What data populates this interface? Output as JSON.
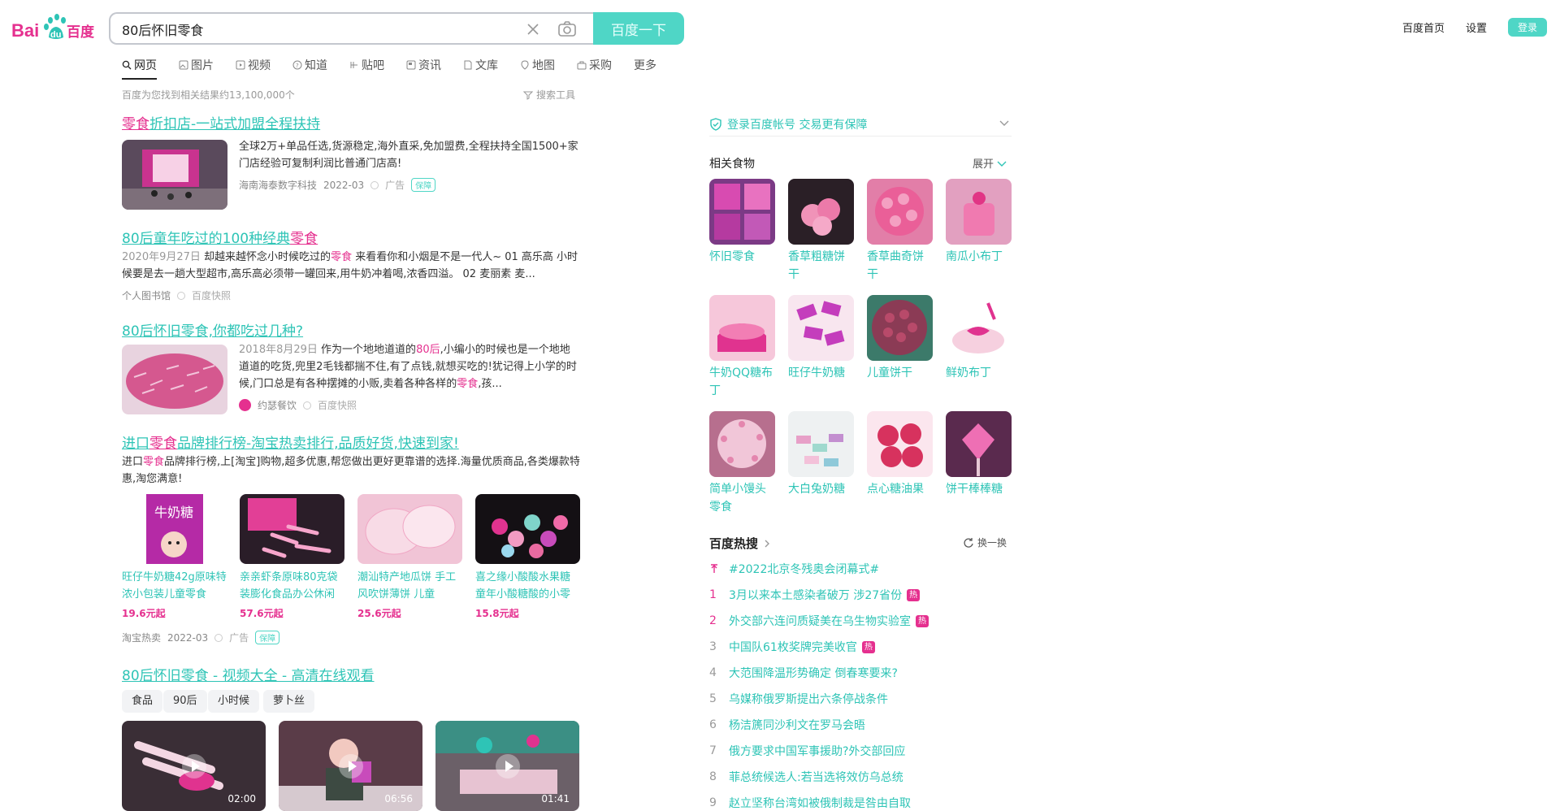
{
  "header": {
    "logo_text_left": "Bai",
    "logo_text_mid": "du",
    "logo_text_right": "百度",
    "search_value": "80后怀旧零食",
    "search_button": "百度一下",
    "links": [
      "百度首页",
      "设置"
    ],
    "login_button": "登录"
  },
  "tabs": [
    {
      "label": "网页",
      "icon": "search-icon",
      "active": true
    },
    {
      "label": "图片",
      "icon": "image-icon"
    },
    {
      "label": "视频",
      "icon": "video-icon"
    },
    {
      "label": "知道",
      "icon": "question-icon"
    },
    {
      "label": "贴吧",
      "icon": "tieba-icon"
    },
    {
      "label": "资讯",
      "icon": "news-icon"
    },
    {
      "label": "文库",
      "icon": "doc-icon"
    },
    {
      "label": "地图",
      "icon": "map-icon"
    },
    {
      "label": "采购",
      "icon": "purchase-icon"
    },
    {
      "label": "更多",
      "icon": ""
    }
  ],
  "results_info": {
    "count_text": "百度为您找到相关结果约13,100,000个",
    "search_tools": "搜索工具"
  },
  "results": [
    {
      "title_hl": "零食",
      "title_rest": "折扣店-一站式加盟全程扶持",
      "desc": "全球2万+单品任选,货源稳定,海外直采,免加盟费,全程扶持全国1500+家门店经验可复制利润比普通门店高!",
      "source": "海南海泰数字科技",
      "date": "2022-03",
      "ad": "广告",
      "guarantee": "保障"
    },
    {
      "title_pre": "80后童年吃过的100种经典",
      "title_hl": "零食",
      "date": "2020年9月27日",
      "desc_a": "却越来越怀念小时候吃过的",
      "desc_hl": "零食",
      "desc_b": " 来看看你和小烟是不是一代人~ 01 高乐高 小时候要是去一趟大型超市,高乐高必须带一罐回来,用牛奶冲着喝,浓香四溢。 02 麦丽素 麦...",
      "source": "个人图书馆",
      "snapshot": "百度快照"
    },
    {
      "title": "80后怀旧零食,你都吃过几种?",
      "date": "2018年8月29日",
      "desc_a": "作为一个地地道道的",
      "desc_hl1": "80后",
      "desc_b": ",小编小的时候也是一个地地道道的吃货,兜里2毛钱都揣不住,有了点钱,就想买吃的!犹记得上小学的时候,门口总是有各种摆摊的小贩,卖着各种各样的",
      "desc_hl2": "零食",
      "desc_c": ",孩...",
      "source": "约瑟餐饮",
      "snapshot": "百度快照"
    },
    {
      "title_pre": "进口",
      "title_hl": "零食",
      "title_rest": "品牌排行榜-淘宝热卖排行,品质好货,快速到家!",
      "desc_a": "进口",
      "desc_hl": "零食",
      "desc_b": "品牌排行榜,上[淘宝]购物,超多优惠,帮您做出更好更靠谱的选择.海量优质商品,各类爆款特惠,淘您满意!",
      "products": [
        {
          "title": "旺仔牛奶糖42g原味特浓小包装儿童零食",
          "price": "19.6元起"
        },
        {
          "title": "亲亲虾条原味80克袋装膨化食品办公休闲",
          "price": "57.6元起"
        },
        {
          "title": "潮汕特产地瓜饼 手工风吹饼薄饼 儿童",
          "price": "25.6元起"
        },
        {
          "title": "喜之缘小酸酸水果糖童年小酸糖酸的小零",
          "price": "15.8元起"
        }
      ],
      "source": "淘宝热卖",
      "date": "2022-03",
      "ad": "广告",
      "guarantee": "保障"
    },
    {
      "title": "80后怀旧零食 - 视频大全 - 高清在线观看",
      "tags": [
        "食品",
        "90后",
        "小时候",
        "萝卜丝"
      ],
      "videos": [
        {
          "duration": "02:00"
        },
        {
          "duration": "06:56"
        },
        {
          "duration": "01:41"
        }
      ]
    }
  ],
  "right": {
    "login_tip": "登录百度帐号 交易更有保障",
    "related_title": "相关食物",
    "expand": "展开",
    "foods": [
      "怀旧零食",
      "香草粗糖饼干",
      "香草曲奇饼干",
      "南瓜小布丁",
      "牛奶QQ糖布丁",
      "旺仔牛奶糖",
      "儿童饼干",
      "鲜奶布丁",
      "简单小馒头零食",
      "大白兔奶糖",
      "点心糖油果",
      "饼干棒棒糖"
    ],
    "hot_title": "百度热搜",
    "refresh": "换一换",
    "hot": [
      {
        "rank": "",
        "text": "#2022北京冬残奥会闭幕式#",
        "badge": ""
      },
      {
        "rank": "1",
        "text": "3月以来本土感染者破万 涉27省份",
        "badge": "热"
      },
      {
        "rank": "2",
        "text": "外交部六连问质疑美在乌生物实验室",
        "badge": "热"
      },
      {
        "rank": "3",
        "text": "中国队61枚奖牌完美收官",
        "badge": "热"
      },
      {
        "rank": "4",
        "text": "大范围降温形势确定 倒春寒要来?",
        "badge": ""
      },
      {
        "rank": "5",
        "text": "乌媒称俄罗斯提出六条停战条件",
        "badge": ""
      },
      {
        "rank": "6",
        "text": "杨洁篪同沙利文在罗马会晤",
        "badge": ""
      },
      {
        "rank": "7",
        "text": "俄方要求中国军事援助?外交部回应",
        "badge": ""
      },
      {
        "rank": "8",
        "text": "菲总统候选人:若当选将效仿乌总统",
        "badge": ""
      },
      {
        "rank": "9",
        "text": "赵立坚称台湾如被俄制裁是咎由自取",
        "badge": ""
      }
    ]
  },
  "colors": {
    "accent": "#2ec4b6",
    "highlight": "#e5308f",
    "button": "#4fd6c6"
  }
}
